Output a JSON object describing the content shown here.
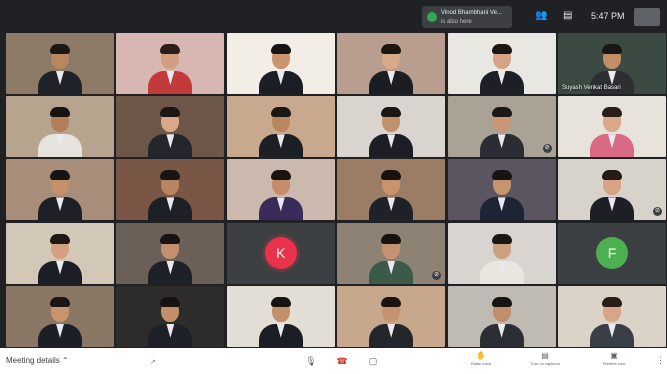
{
  "topbar": {
    "presenter_name": "Vinod Bhambhani Ve...",
    "presenter_sub": "is also here",
    "people_icon": "people-icon",
    "chat_icon": "chat-icon",
    "time": "5:47 PM"
  },
  "colors": {
    "meet_dark": "#202124",
    "avatar_k": "#e8334a",
    "avatar_f": "#4caf50",
    "hangup": "#d93025"
  },
  "tiles": [
    {
      "id": "r1c1",
      "bg": "#8d7b67",
      "skin": "#b8865f",
      "hair": "#1b1815",
      "suit": "#1f2228",
      "name": ""
    },
    {
      "id": "r1c2",
      "bg": "#d8b7b2",
      "skin": "#d19f7e",
      "hair": "#2b1e19",
      "suit": "#c23a3a",
      "name": ""
    },
    {
      "id": "r1c3",
      "bg": "#f2eee6",
      "skin": "#c9946e",
      "hair": "#161413",
      "suit": "#1b1e24",
      "name": ""
    },
    {
      "id": "r1c4",
      "bg": "#b99d8e",
      "skin": "#d8a98a",
      "hair": "#1f1612",
      "suit": "#1a1d22",
      "name": ""
    },
    {
      "id": "r1c5",
      "bg": "#e9e7e2",
      "skin": "#d6a384",
      "hair": "#1c1513",
      "suit": "#1c1f25",
      "name": ""
    },
    {
      "id": "r1c6",
      "bg": "#3b4a42",
      "skin": "#c28e68",
      "hair": "#191614",
      "suit": "#2d2f33",
      "name": "Suyash Venkat Basari"
    },
    {
      "id": "r2c1",
      "bg": "#b7a48e",
      "skin": "#b47e58",
      "hair": "#171412",
      "suit": "#e6e3dd",
      "name": ""
    },
    {
      "id": "r2c2",
      "bg": "#6e5648",
      "skin": "#d8a888",
      "hair": "#1c1614",
      "suit": "#23262c",
      "name": ""
    },
    {
      "id": "r2c3",
      "bg": "#c9a98e",
      "skin": "#b98660",
      "hair": "#1a1715",
      "suit": "#1c1f24",
      "name": ""
    },
    {
      "id": "r2c4",
      "bg": "#d9d5ce",
      "skin": "#c2916c",
      "hair": "#1b1714",
      "suit": "#1b1e24",
      "name": ""
    },
    {
      "id": "r2c5",
      "bg": "#a9a295",
      "skin": "#c99775",
      "hair": "#1d1916",
      "suit": "#2a2d33",
      "name": "",
      "muted": true
    },
    {
      "id": "r2c6",
      "bg": "#e7e2da",
      "skin": "#d9a98b",
      "hair": "#2a1c16",
      "suit": "#d86a84",
      "name": ""
    },
    {
      "id": "r3c1",
      "bg": "#a98d7b",
      "skin": "#c48f69",
      "hair": "#161311",
      "suit": "#1d2026",
      "name": ""
    },
    {
      "id": "r3c2",
      "bg": "#7a5647",
      "skin": "#b98560",
      "hair": "#171412",
      "suit": "#1d2027",
      "name": ""
    },
    {
      "id": "r3c3",
      "bg": "#cbb9ad",
      "skin": "#c48c6a",
      "hair": "#1b1512",
      "suit": "#3a2c5a",
      "name": ""
    },
    {
      "id": "r3c4",
      "bg": "#9b7d66",
      "skin": "#c89470",
      "hair": "#171311",
      "suit": "#1e2127",
      "name": ""
    },
    {
      "id": "r3c5",
      "bg": "#5a5560",
      "skin": "#c6946f",
      "hair": "#161311",
      "suit": "#1d2434",
      "name": ""
    },
    {
      "id": "r3c6",
      "bg": "#d7d2ca",
      "skin": "#d6a385",
      "hair": "#261a15",
      "suit": "#1c1f25",
      "name": "",
      "muted": true
    },
    {
      "id": "r4c1",
      "bg": "#d3c7b8",
      "skin": "#d3a080",
      "hair": "#1f1713",
      "suit": "#1b1e24",
      "name": ""
    },
    {
      "id": "r4c2",
      "bg": "#6a6058",
      "skin": "#c29070",
      "hair": "#171412",
      "suit": "#1d2026",
      "name": ""
    },
    {
      "id": "r4c3",
      "avatar": "K",
      "avatar_color": "#e8334a",
      "name": ""
    },
    {
      "id": "r4c4",
      "bg": "#8e8274",
      "skin": "#c59270",
      "hair": "#161412",
      "suit": "#3b5a4a",
      "name": "",
      "muted": true
    },
    {
      "id": "r4c5",
      "bg": "#d8d4cf",
      "skin": "#caa081",
      "hair": "#1c1713",
      "suit": "#e9e5df",
      "name": ""
    },
    {
      "id": "r4c6",
      "avatar": "F",
      "avatar_color": "#4caf50",
      "name": ""
    },
    {
      "id": "r5c1",
      "bg": "#8a7766",
      "skin": "#c8956f",
      "hair": "#1b1613",
      "suit": "#1c1f25",
      "name": ""
    },
    {
      "id": "r5c2",
      "bg": "#2e2c2a",
      "skin": "#c38f6b",
      "hair": "#161311",
      "suit": "#1d2026",
      "name": ""
    },
    {
      "id": "r5c3",
      "bg": "#e2ddd5",
      "skin": "#c48f6b",
      "hair": "#181412",
      "suit": "#1b1e24",
      "name": ""
    },
    {
      "id": "r5c4",
      "bg": "#c8a88c",
      "skin": "#c69370",
      "hair": "#1a1512",
      "suit": "#23262b",
      "name": ""
    },
    {
      "id": "r5c5",
      "bg": "#bfbab2",
      "skin": "#c08e6a",
      "hair": "#171311",
      "suit": "#2b2e33",
      "name": ""
    },
    {
      "id": "r5c6",
      "bg": "#dcd3c8",
      "skin": "#d8a586",
      "hair": "#2a1d17",
      "suit": "#3a3e46",
      "name": ""
    }
  ],
  "bottombar": {
    "meeting_details": "Meeting details",
    "chevron_icon": "chevron-up-icon",
    "mic_icon": "microphone-icon",
    "hangup_icon": "hangup-icon",
    "camera_icon": "camera-icon",
    "raise_hand_label": "Raise hand",
    "captions_label": "Turn on captions",
    "present_label": "Present now",
    "more_icon": "more-vertical-icon"
  }
}
